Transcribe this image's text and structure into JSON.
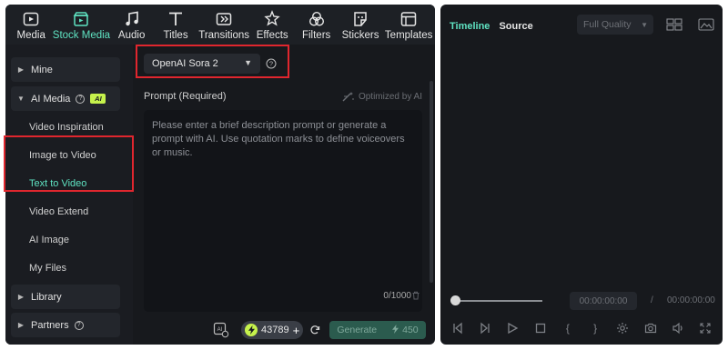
{
  "toolbar": {
    "items": [
      {
        "label": "Media",
        "icon": "media-icon"
      },
      {
        "label": "Stock Media",
        "icon": "stock-media-icon",
        "active": true
      },
      {
        "label": "Audio",
        "icon": "music-note-icon"
      },
      {
        "label": "Titles",
        "icon": "text-t-icon"
      },
      {
        "label": "Transitions",
        "icon": "transitions-icon"
      },
      {
        "label": "Effects",
        "icon": "effects-star-icon"
      },
      {
        "label": "Filters",
        "icon": "filters-icon"
      },
      {
        "label": "Stickers",
        "icon": "sticker-icon"
      },
      {
        "label": "Templates",
        "icon": "templates-icon"
      }
    ]
  },
  "sidebar": {
    "mine": "Mine",
    "ai_media": "AI Media",
    "ai_badge": "AI",
    "sub_items": [
      "Video Inspiration",
      "Image to Video",
      "Text to Video",
      "Video Extend",
      "AI Image",
      "My Files"
    ],
    "active_sub": "Text to Video",
    "library": "Library",
    "partners": "Partners"
  },
  "content": {
    "model": "OpenAI Sora 2",
    "prompt_label": "Prompt (Required)",
    "optimized_label": "Optimized by AI",
    "prompt_placeholder": "Please enter a brief description prompt or generate a prompt with AI. Use quotation marks to define voiceovers or music.",
    "char_count": "0/1000",
    "credits": "43789",
    "generate_label": "Generate",
    "generate_cost": "450"
  },
  "preview": {
    "tabs": [
      "Timeline",
      "Source"
    ],
    "active_tab": "Timeline",
    "quality": "Full Quality",
    "current_time": "00:00:00:00",
    "separator": "/",
    "total_time": "00:00:00:00"
  },
  "colors": {
    "accent": "#5fe3c2",
    "highlight": "#e0262e",
    "credit_green": "#c6f24c",
    "panel_bg": "#17191d"
  }
}
